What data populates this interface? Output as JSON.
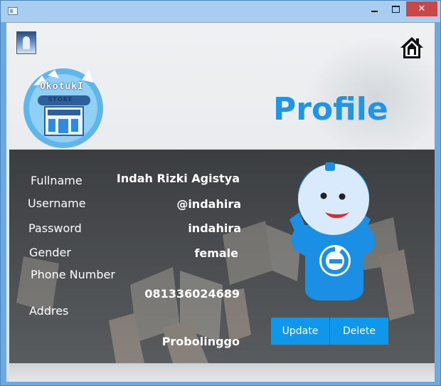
{
  "window": {
    "controls": {
      "minimize_icon": "minimize-icon",
      "maximize_icon": "maximize-icon",
      "close_label": "✕"
    }
  },
  "header": {
    "title": "Profile",
    "logo_text": "OkotukI",
    "logo_store": "STORE",
    "home_icon": "home-icon"
  },
  "profile": {
    "fields": [
      {
        "label": "Fullname",
        "value": "Indah Rizki Agistya"
      },
      {
        "label": "Username",
        "value": "@indahira"
      },
      {
        "label": "Password",
        "value": "indahira"
      },
      {
        "label": "Gender",
        "value": "female"
      },
      {
        "label": "Phone Number",
        "value": "081336024689"
      },
      {
        "label": "Addres",
        "value": "Probolinggo"
      }
    ]
  },
  "actions": {
    "update_label": "Update",
    "delete_label": "Delete"
  },
  "colors": {
    "accent": "#1f95e6",
    "button": "#0f97ec",
    "panel": "#45484b",
    "titlebar": "#a9cdee",
    "close": "#c74848"
  }
}
